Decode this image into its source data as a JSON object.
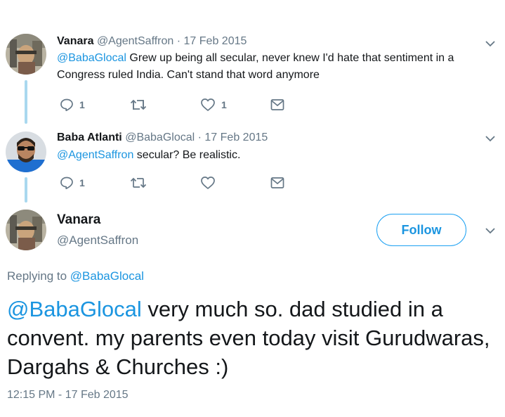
{
  "tweet1": {
    "name": "Vanara",
    "handle": "@AgentSaffron",
    "sep": "·",
    "date": "17 Feb 2015",
    "mention": "@BabaGlocal",
    "text": " Grew up being all secular, never knew I'd hate that sentiment in a Congress ruled India. Can't stand that word anymore",
    "reply_count": "1",
    "like_count": "1"
  },
  "tweet2": {
    "name": "Baba Atlanti",
    "handle": "@BabaGlocal",
    "sep": "·",
    "date": "17 Feb 2015",
    "mention": "@AgentSaffron",
    "text": " secular? Be realistic.",
    "reply_count": "1"
  },
  "main": {
    "name": "Vanara",
    "handle": "@AgentSaffron",
    "follow_label": "Follow",
    "replying_label": "Replying to",
    "replying_to": "@BabaGlocal",
    "mention": "@BabaGlocal",
    "text": " very much so. dad studied in a convent. my parents even today visit Gurudwaras, Dargahs & Churches :)",
    "timestamp": "12:15 PM - 17 Feb 2015"
  },
  "icons": {
    "reply": "reply-icon",
    "retweet": "retweet-icon",
    "like": "heart-icon",
    "dm": "envelope-icon",
    "more": "chevron-down-icon"
  },
  "colors": {
    "accent": "#1da1f2",
    "link": "#1b95e0",
    "muted": "#657786",
    "thread_line": "#a9d8ef"
  }
}
